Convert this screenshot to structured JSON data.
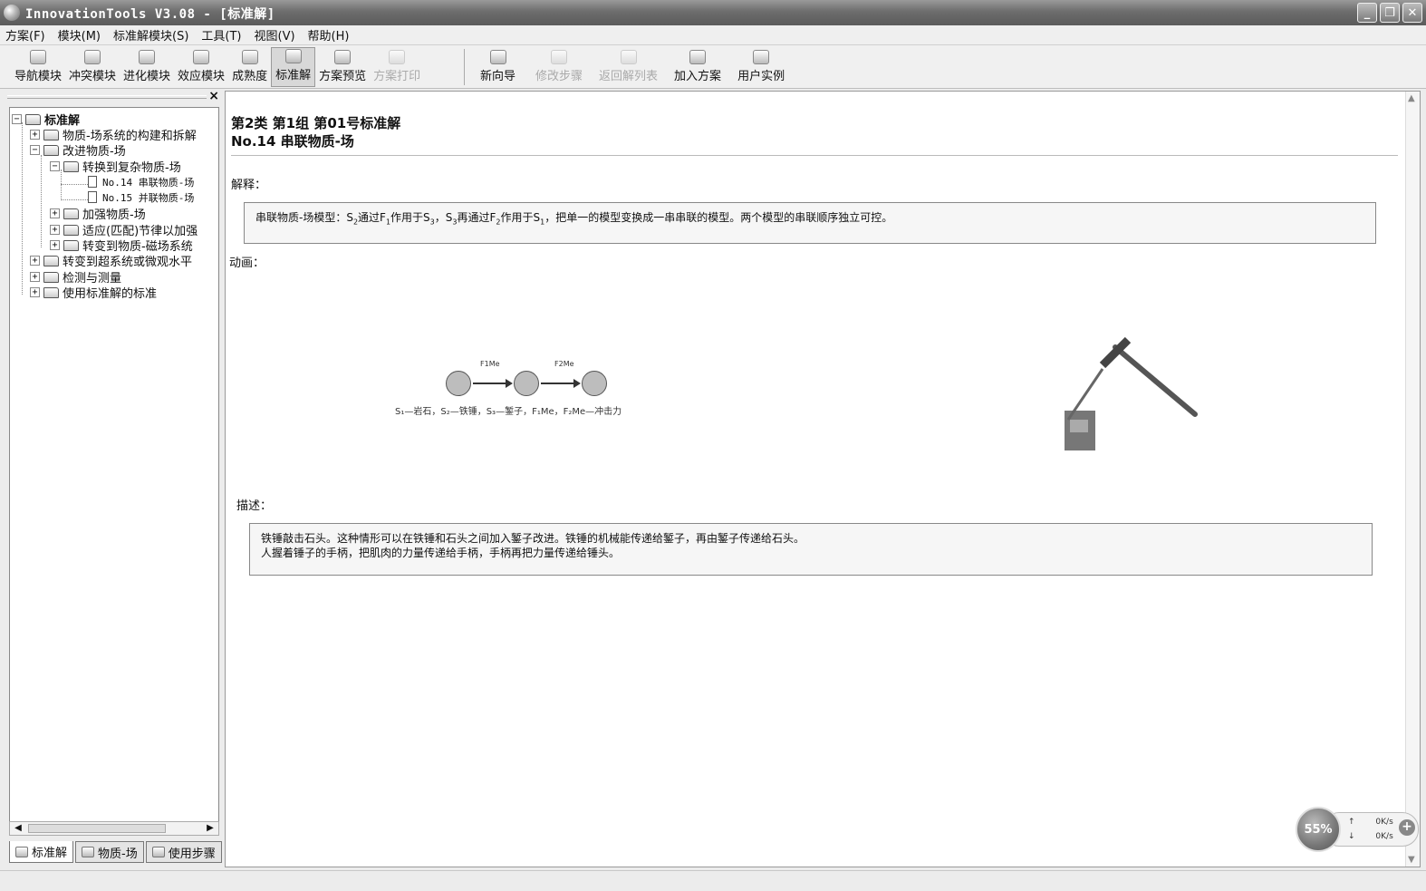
{
  "window": {
    "title": "InnovationTools V3.08 - [标准解]",
    "buttons": [
      "_",
      "❐",
      "✕"
    ]
  },
  "menu": [
    "方案(F)",
    "模块(M)",
    "标准解模块(S)",
    "工具(T)",
    "视图(V)",
    "帮助(H)"
  ],
  "toolbar": {
    "group1": [
      {
        "label": "导航模块",
        "state": "normal"
      },
      {
        "label": "冲突模块",
        "state": "normal"
      },
      {
        "label": "进化模块",
        "state": "normal"
      },
      {
        "label": "效应模块",
        "state": "normal"
      },
      {
        "label": "成熟度",
        "state": "normal"
      },
      {
        "label": "标准解",
        "state": "active"
      },
      {
        "label": "方案预览",
        "state": "normal"
      },
      {
        "label": "方案打印",
        "state": "disabled"
      }
    ],
    "group2": [
      {
        "label": "新向导",
        "state": "normal"
      },
      {
        "label": "修改步骤",
        "state": "disabled"
      },
      {
        "label": "返回解列表",
        "state": "disabled"
      },
      {
        "label": "加入方案",
        "state": "normal"
      },
      {
        "label": "用户实例",
        "state": "normal"
      }
    ]
  },
  "tree": {
    "close": "×",
    "root": "标准解",
    "n1": "物质-场系统的构建和拆解",
    "n2": "改进物质-场",
    "n2_1": "转换到复杂物质-场",
    "n2_1_1": "No.14 串联物质-场",
    "n2_1_2": "No.15 并联物质-场",
    "n2_2": "加强物质-场",
    "n2_3": "适应(匹配)节律以加强",
    "n2_4": "转变到物质-磁场系统",
    "n3": "转变到超系统或微观水平",
    "n4": "检测与测量",
    "n5": "使用标准解的标准",
    "plus": "+",
    "minus": "−"
  },
  "tabs": [
    "标准解",
    "物质-场",
    "使用步骤"
  ],
  "content": {
    "heading1": "第2类 第1组 第01号标准解",
    "heading2": "No.14 串联物质-场",
    "explain_label": "解释：",
    "explain_text": {
      "p1": "串联物质-场模型：S",
      "s1": "2",
      "p2": "通过F",
      "s2": "1",
      "p3": "作用于S",
      "s3": "3",
      "p4": "，S",
      "s4": "3",
      "p5": "再通过F",
      "s5": "2",
      "p6": "作用于S",
      "s6": "1",
      "p7": "，把单一的模型变换成一串串联的模型。两个模型的串联顺序独立可控。"
    },
    "anim_label": "动画：",
    "diagram": {
      "f1": "F1Me",
      "f2": "F2Me",
      "caption": "S₁—岩石，S₂—铁锤，S₃—錾子，F₁Me，F₂Me—冲击力"
    },
    "desc_label": "描述：",
    "desc_line1": "铁锤敲击石头。这种情形可以在铁锤和石头之间加入錾子改进。铁锤的机械能传递给錾子，再由錾子传递给石头。",
    "desc_line2": "人握着锤子的手柄，把肌肉的力量传递给手柄，手柄再把力量传递给锤头。"
  },
  "netwidget": {
    "percent": "55%",
    "up": "0K/s",
    "down": "0K/s",
    "up_arrow": "↑",
    "down_arrow": "↓",
    "plus": "+"
  }
}
